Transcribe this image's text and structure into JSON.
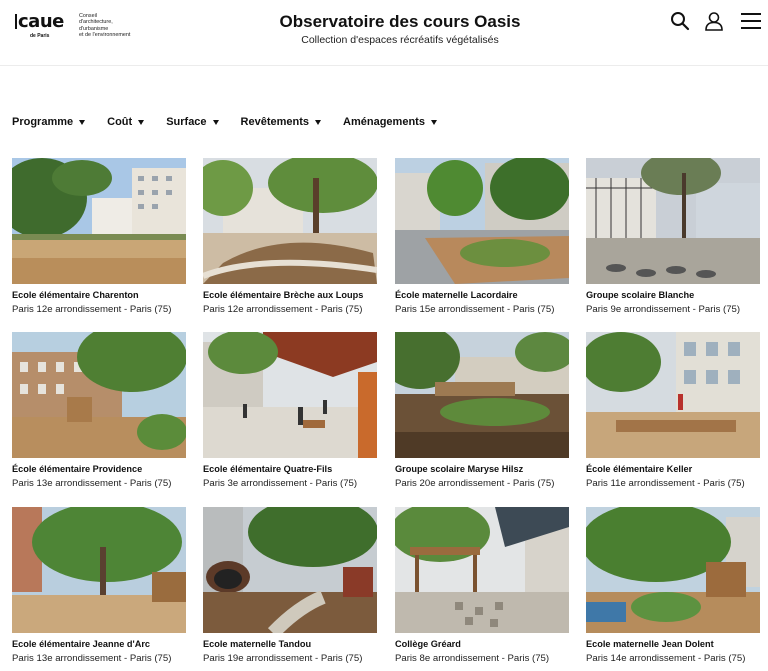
{
  "header": {
    "logo_mark": "caue",
    "logo_sub": "de Paris",
    "logo_text": "Conseil\nd'architecture,\nd'urbanisme\net de l'environnement",
    "title": "Observatoire des cours Oasis",
    "subtitle": "Collection d'espaces récréatifs végétalisés",
    "icons": [
      "search-icon",
      "user-icon",
      "menu-icon"
    ]
  },
  "filters": [
    {
      "label": "Programme"
    },
    {
      "label": "Coût"
    },
    {
      "label": "Surface"
    },
    {
      "label": "Revêtements"
    },
    {
      "label": "Aménagements"
    }
  ],
  "cards": [
    {
      "title": "Ecole élémentaire Charenton",
      "subtitle": "Paris 12e arrondissement - Paris (75)"
    },
    {
      "title": "Ecole élémentaire Brèche aux Loups",
      "subtitle": "Paris 12e arrondissement - Paris (75)"
    },
    {
      "title": "École maternelle Lacordaire",
      "subtitle": "Paris 15e arrondissement - Paris (75)"
    },
    {
      "title": "Groupe scolaire Blanche",
      "subtitle": "Paris 9e arrondissement - Paris (75)"
    },
    {
      "title": "École élémentaire Providence",
      "subtitle": "Paris 13e arrondissement - Paris (75)"
    },
    {
      "title": "Ecole élémentaire Quatre-Fils",
      "subtitle": "Paris 3e arrondissement - Paris (75)"
    },
    {
      "title": "Groupe scolaire Maryse Hilsz",
      "subtitle": "Paris 20e arrondissement - Paris (75)"
    },
    {
      "title": "École élémentaire Keller",
      "subtitle": "Paris 11e arrondissement - Paris (75)"
    },
    {
      "title": "Ecole élémentaire Jeanne d'Arc",
      "subtitle": "Paris 13e arrondissement - Paris (75)"
    },
    {
      "title": "Ecole maternelle Tandou",
      "subtitle": "Paris 19e arrondissement - Paris (75)"
    },
    {
      "title": "Collège Gréard",
      "subtitle": "Paris 8e arrondissement - Paris (75)"
    },
    {
      "title": "Ecole maternelle Jean Dolent",
      "subtitle": "Paris 14e arrondissement - Paris (75)"
    }
  ]
}
